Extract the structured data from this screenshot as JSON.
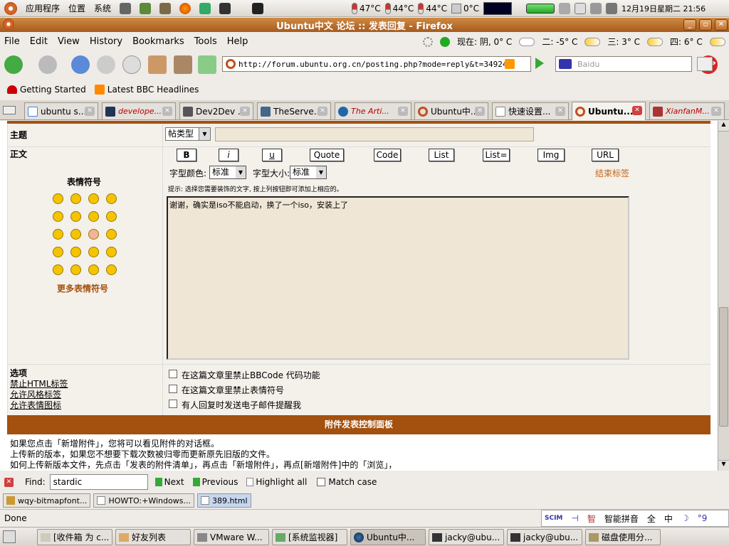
{
  "top_panel": {
    "menus": [
      "应用程序",
      "位置",
      "系统"
    ],
    "sensors": [
      "47°C",
      "44°C",
      "44°C",
      "0°C"
    ],
    "clock": "12月19日星期二 21:56"
  },
  "window": {
    "title": "Ubuntu中文 论坛 :: 发表回复 - Firefox"
  },
  "menubar": {
    "items": [
      "File",
      "Edit",
      "View",
      "History",
      "Bookmarks",
      "Tools",
      "Help"
    ]
  },
  "weather": {
    "today": "现在: 阴, 0° C",
    "day2": "二: -5° C",
    "day3": "三: 3° C",
    "day4": "四: 6° C"
  },
  "toolbar": {
    "url": "http://forum.ubuntu.org.cn/posting.php?mode=reply&t=34924",
    "search_placeholder": "Baidu"
  },
  "bookmarks": [
    "Getting Started",
    "Latest BBC Headlines"
  ],
  "tabs": [
    "ubuntu s...",
    "develope...",
    "Dev2Dev ...",
    "TheServe...",
    "The Arti...",
    "Ubuntu中...",
    "快速设置...",
    "Ubuntu...",
    "XianfanM..."
  ],
  "form": {
    "subject_label": "主题",
    "subject_select": "帖类型",
    "body_label": "正文",
    "emoticons_title": "表情符号",
    "more_emoticons": "更多表情符号",
    "format_buttons": [
      "B",
      "i",
      "u",
      "Quote",
      "Code",
      "List",
      "List=",
      "Img",
      "URL"
    ],
    "color_label": "字型颜色:",
    "color_value": "标准",
    "size_label": "字型大小:",
    "size_value": "标准",
    "close_tags": "结束标签",
    "hint": "提示: 选择您需要装饰的文字, 按上列按钮即可添加上相应的。",
    "message": "谢谢，确实是iso不能启动，换了一个iso，安装上了",
    "options_label": "选项",
    "options_left": [
      "禁止HTML标签",
      "允许风格标签",
      "允许表情图标"
    ],
    "checkboxes": [
      "在这篇文章里禁止BBCode 代码功能",
      "在这篇文章里禁止表情符号",
      "有人回复时发送电子邮件提醒我"
    ]
  },
  "attachment": {
    "header": "附件发表控制面板",
    "lines": [
      "如果您点击「新增附件」，您将可以看见附件的对话框。",
      "上传新的版本，如果您不想要下载次数被归零而更新原先旧版的文件。",
      "如何上传新版本文件，先点击「发表的附件清单」，再点击「新增附件」，再点[新增附件]中的「浏览」，"
    ]
  },
  "findbar": {
    "label": "Find:",
    "value": "stardic",
    "next": "Next",
    "previous": "Previous",
    "highlight": "Highlight all",
    "match_case": "Match case"
  },
  "downloads": [
    "wqy-bitmapfont...",
    "HOWTO:+Windows...",
    "389.html"
  ],
  "status": {
    "text": "Done"
  },
  "ime": {
    "items": [
      "智能拼音",
      "全",
      "中"
    ]
  },
  "taskbar": [
    "[收件箱 为 c...",
    "好友列表",
    "VMware W...",
    "[系统监视器]",
    "Ubuntu中...",
    "jacky@ubu...",
    "jacky@ubu...",
    "磁盘使用分..."
  ],
  "colors": {
    "title_orange": "#b4662a",
    "header_brown": "#a4500e",
    "tag_orange": "#c4661a",
    "textarea_bg": "#efe6d6"
  }
}
